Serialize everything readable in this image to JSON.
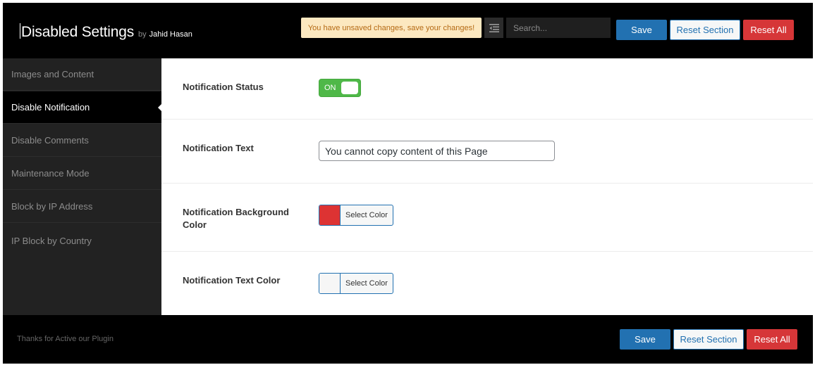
{
  "header": {
    "title": "Disabled Settings",
    "by": "by",
    "author": "Jahid Hasan",
    "notice": "You have unsaved changes, save your changes!",
    "search_placeholder": "Search...",
    "save_label": "Save",
    "reset_section_label": "Reset Section",
    "reset_all_label": "Reset All"
  },
  "sidebar": {
    "items": [
      {
        "label": "Images and Content",
        "active": false
      },
      {
        "label": "Disable Notification",
        "active": true
      },
      {
        "label": "Disable Comments",
        "active": false
      },
      {
        "label": "Maintenance Mode",
        "active": false
      },
      {
        "label": "Block by IP Address",
        "active": false
      },
      {
        "label": "IP Block by Country",
        "active": false
      }
    ]
  },
  "fields": {
    "status": {
      "label": "Notification Status",
      "toggle_text": "ON",
      "value": true
    },
    "text": {
      "label": "Notification Text",
      "value": "You cannot copy content of this Page"
    },
    "bg_color": {
      "label": "Notification Background Color",
      "button": "Select Color",
      "color": "#dd3333"
    },
    "text_color": {
      "label": "Notification Text Color",
      "button": "Select Color",
      "color": "#f6f6f6"
    }
  },
  "footer": {
    "text": "Thanks for Active our Plugin",
    "save_label": "Save",
    "reset_section_label": "Reset Section",
    "reset_all_label": "Reset All"
  },
  "colors": {
    "primary": "#2271b1",
    "danger": "#d63638",
    "toggle_on": "#4fb848",
    "notice_bg": "#fce8c0"
  },
  "icons": {
    "expand": "expand-list-icon"
  }
}
